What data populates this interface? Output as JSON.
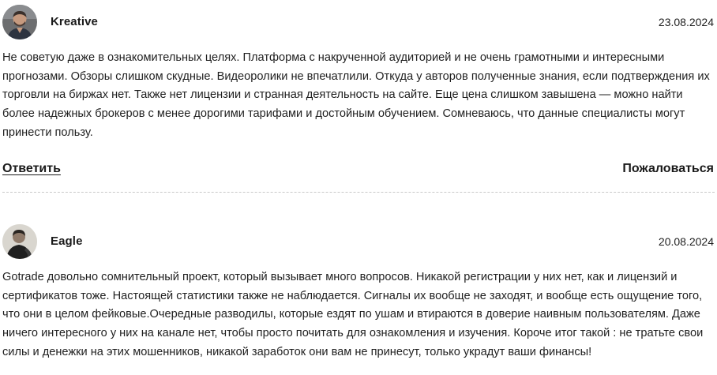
{
  "reviews": [
    {
      "author": "Kreative",
      "date": "23.08.2024",
      "text": "Не советую даже в ознакомительных целях. Платформа с накрученной аудиторией и не очень грамотными и интересными прогнозами. Обзоры слишком скудные. Видеоролики не впечатлили. Откуда у авторов полученные знания, если подтверждения их торговли на биржах нет. Также нет лицензии и странная деятельность на сайте. Еще цена слишком завышена — можно найти более надежных брокеров с менее дорогими тарифами и достойным обучением. Сомневаюсь, что данные специалисты могут принести пользу.",
      "reply_label": "Ответить",
      "report_label": "Пожаловаться"
    },
    {
      "author": "Eagle",
      "date": "20.08.2024",
      "text": "Gotrade довольно сомнительный проект, который вызывает много вопросов. Никакой регистрации у них нет, как и лицензий и сертификатов тоже. Настоящей статистики также не наблюдается. Сигналы их вообще не заходят, и вообще есть ощущение того, что они в целом фейковые.Очередные разводилы, которые ездят по ушам и втираются в доверие наивным пользователям. Даже ничего интересного у них на канале нет, чтобы просто почитать для ознакомления и изучения. Короче итог такой : не тратьте свои силы и денежки на этих мошенников, никакой заработок они вам не принесут, только украдут ваши финансы!"
    }
  ]
}
